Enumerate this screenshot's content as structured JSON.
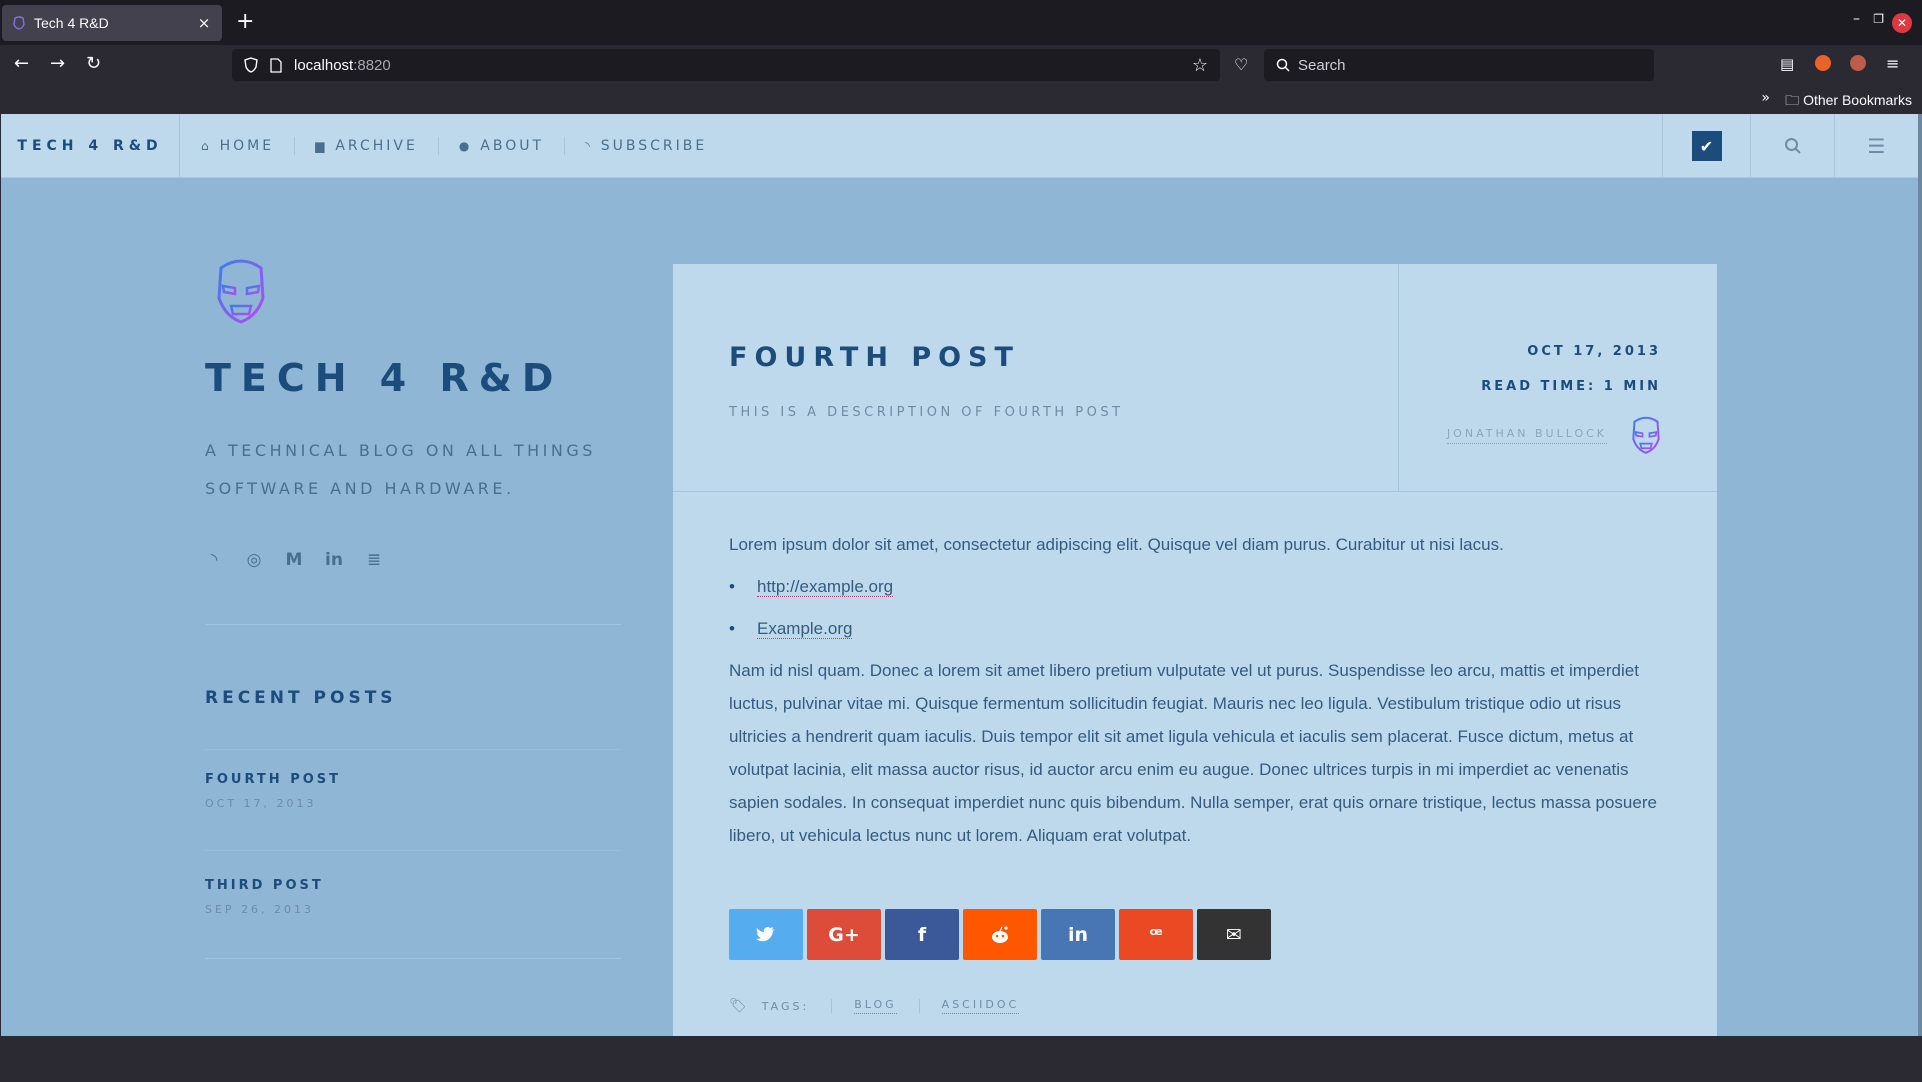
{
  "browser": {
    "tab_title": "Tech 4 R&D",
    "tab_close": "×",
    "new_tab": "+",
    "url_host": "localhost",
    "url_port": ":8820",
    "search_placeholder": "Search",
    "other_bookmarks": "Other Bookmarks"
  },
  "site_nav": {
    "brand": "TECH 4 R&D",
    "links": [
      {
        "label": "HOME",
        "icon": "home-icon"
      },
      {
        "label": "ARCHIVE",
        "icon": "archive-icon"
      },
      {
        "label": "ABOUT",
        "icon": "user-icon"
      },
      {
        "label": "SUBSCRIBE",
        "icon": "rss-icon"
      }
    ]
  },
  "sidebar": {
    "title": "TECH 4 R&D",
    "description": "A TECHNICAL BLOG ON ALL THINGS SOFTWARE AND HARDWARE.",
    "social_icons": [
      "rss-icon",
      "github-icon",
      "medium-icon",
      "linkedin-icon",
      "stackoverflow-icon"
    ],
    "recent_title": "RECENT POSTS",
    "recent_posts": [
      {
        "title": "FOURTH POST",
        "date": "OCT 17, 2013"
      },
      {
        "title": "THIRD POST",
        "date": "SEP 26, 2013"
      }
    ]
  },
  "article": {
    "title": "FOURTH POST",
    "description": "THIS IS A DESCRIPTION OF FOURTH POST",
    "date": "OCT 17, 2013",
    "read_time": "READ TIME: 1 MIN",
    "author": "JONATHAN BULLOCK",
    "intro": "Lorem ipsum dolor sit amet, consectetur adipiscing elit. Quisque vel diam purus. Curabitur ut nisi lacus.",
    "links": [
      "http://example.org",
      "Example.org"
    ],
    "body": "Nam id nisl quam. Donec a lorem sit amet libero pretium vulputate vel ut purus. Suspendisse leo arcu, mattis et imperdiet luctus, pulvinar vitae mi. Quisque fermentum sollicitudin feugiat. Mauris nec leo ligula. Vestibulum tristique odio ut risus ultricies a hendrerit quam iaculis. Duis tempor elit sit amet ligula vehicula et iaculis sem placerat. Fusce dictum, metus at volutpat lacinia, elit massa auctor risus, id auctor arcu enim eu augue. Donec ultrices turpis in mi imperdiet ac venenatis sapien sodales. In consequat imperdiet nunc quis bibendum. Nulla semper, erat quis ornare tristique, lectus massa posuere libero, ut vehicula lectus nunc ut lorem. Aliquam erat volutpat.",
    "share_buttons": [
      {
        "name": "twitter",
        "glyph": "🐦",
        "color": "#55acee"
      },
      {
        "name": "google-plus",
        "glyph": "G+",
        "color": "#dd4b39"
      },
      {
        "name": "facebook",
        "glyph": "f",
        "color": "#3b5998"
      },
      {
        "name": "reddit",
        "glyph": "☻",
        "color": "#ff5700"
      },
      {
        "name": "linkedin",
        "glyph": "in",
        "color": "#4875b4"
      },
      {
        "name": "stumbleupon",
        "glyph": "ꟹ",
        "color": "#eb4924"
      },
      {
        "name": "email",
        "glyph": "✉",
        "color": "#333333"
      }
    ],
    "tags_label": "TAGS:",
    "tags": [
      "BLOG",
      "ASCIIDOC"
    ]
  },
  "colors": {
    "accent": "#1c4c7c",
    "page_bg": "#90b6d6",
    "panel_bg": "#bfd9ec"
  }
}
